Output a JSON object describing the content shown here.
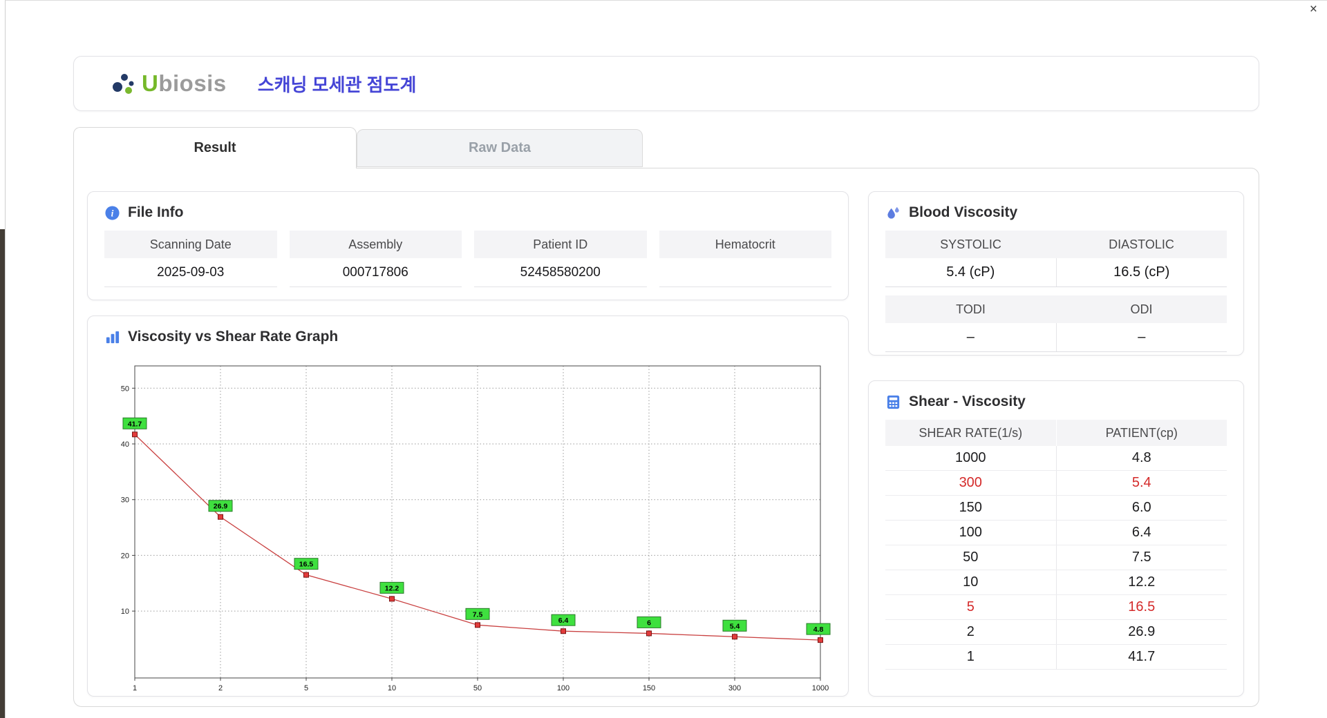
{
  "window": {
    "close_label": "×"
  },
  "header": {
    "logo_u": "U",
    "logo_rest": "biosis",
    "title": "스캐닝 모세관 점도계"
  },
  "tabs": [
    {
      "label": "Result",
      "active": true
    },
    {
      "label": "Raw Data",
      "active": false
    }
  ],
  "file_info": {
    "title": "File Info",
    "fields": [
      {
        "label": "Scanning Date",
        "value": "2025-09-03"
      },
      {
        "label": "Assembly",
        "value": "000717806"
      },
      {
        "label": "Patient ID",
        "value": "52458580200"
      },
      {
        "label": "Hematocrit",
        "value": ""
      }
    ]
  },
  "graph": {
    "title": "Viscosity vs Shear Rate Graph"
  },
  "blood_viscosity": {
    "title": "Blood Viscosity",
    "rows": [
      {
        "headers": [
          "SYSTOLIC",
          "DIASTOLIC"
        ],
        "values": [
          "5.4 (cP)",
          "16.5 (cP)"
        ]
      },
      {
        "headers": [
          "TODI",
          "ODI"
        ],
        "values": [
          "–",
          "–"
        ]
      }
    ]
  },
  "shear_viscosity": {
    "title": "Shear - Viscosity",
    "columns": [
      "SHEAR RATE(1/s)",
      "PATIENT(cp)"
    ],
    "rows": [
      {
        "shear": "1000",
        "patient": "4.8",
        "highlight": false
      },
      {
        "shear": "300",
        "patient": "5.4",
        "highlight": true
      },
      {
        "shear": "150",
        "patient": "6.0",
        "highlight": false
      },
      {
        "shear": "100",
        "patient": "6.4",
        "highlight": false
      },
      {
        "shear": "50",
        "patient": "7.5",
        "highlight": false
      },
      {
        "shear": "10",
        "patient": "12.2",
        "highlight": false
      },
      {
        "shear": "5",
        "patient": "16.5",
        "highlight": true
      },
      {
        "shear": "2",
        "patient": "26.9",
        "highlight": false
      },
      {
        "shear": "1",
        "patient": "41.7",
        "highlight": false
      }
    ]
  },
  "chart_data": {
    "type": "line",
    "title": "Viscosity vs Shear Rate Graph",
    "x": [
      1,
      2,
      5,
      10,
      50,
      100,
      150,
      300,
      1000
    ],
    "values": [
      41.7,
      26.9,
      16.5,
      12.2,
      7.5,
      6.4,
      6,
      5.4,
      4.8
    ],
    "point_labels": [
      "41.7",
      "26.9",
      "16.5",
      "12.2",
      "7.5",
      "6.4",
      "6",
      "5.4",
      "4.8"
    ],
    "yticks": [
      10,
      20,
      30,
      40,
      50
    ],
    "ylim": [
      -2,
      54
    ],
    "x_scale": "category",
    "grid": true,
    "line_color": "#c94040",
    "marker_color": "#e23b3b",
    "marker_border": "#7a1212",
    "label_bg": "#3fe03f",
    "label_border": "#2a7a2a"
  },
  "icons": {
    "file_info": "info-icon",
    "graph": "bar-chart-icon",
    "blood": "droplet-icon",
    "shear": "calculator-icon",
    "close": "close-icon"
  }
}
